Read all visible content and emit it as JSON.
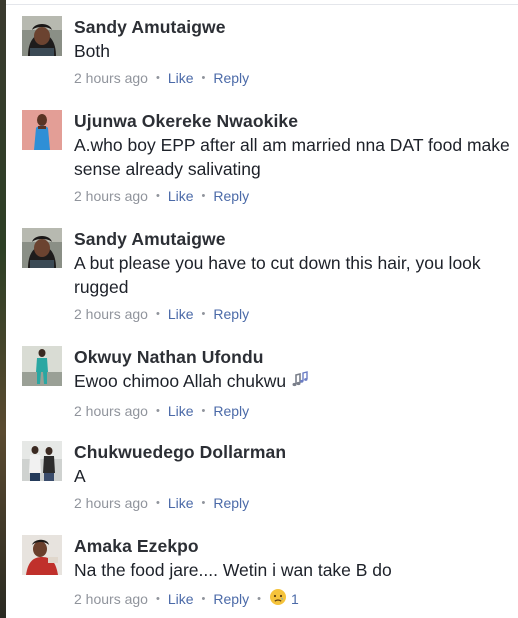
{
  "colors": {
    "author": "#2c2f35",
    "text": "#1d2129",
    "meta": "#90949c",
    "link": "#4b6aa8"
  },
  "comments": [
    {
      "author": "Sandy Amutaigwe",
      "text": "Both",
      "time": "2 hours ago",
      "like": "Like",
      "reply": "Reply",
      "avatar": "avatar-photo-woman-braids"
    },
    {
      "author": "Ujunwa Okereke Nwaokike",
      "text": "A.who boy EPP after all am married nna DAT food make sense already salivating",
      "time": "2 hours ago",
      "like": "Like",
      "reply": "Reply",
      "avatar": "avatar-photo-woman-blue-dress"
    },
    {
      "author": "Sandy Amutaigwe",
      "text": "A  but please you have to cut down this hair, you look rugged",
      "time": "2 hours ago",
      "like": "Like",
      "reply": "Reply",
      "avatar": "avatar-photo-woman-braids"
    },
    {
      "author": "Okwuy Nathan Ufondu",
      "text": "Ewoo chimoo Allah chukwu",
      "emoji": "music-notes-icon",
      "time": "2 hours ago",
      "like": "Like",
      "reply": "Reply",
      "avatar": "avatar-photo-man-teal-outfit"
    },
    {
      "author": "Chukwuedego Dollarman",
      "text": "A",
      "time": "2 hours ago",
      "like": "Like",
      "reply": "Reply",
      "avatar": "avatar-photo-two-men"
    },
    {
      "author": "Amaka Ezekpo",
      "text": "Na the food jare.... Wetin i wan take B do",
      "time": "2 hours ago",
      "like": "Like",
      "reply": "Reply",
      "reaction": "sad-face-icon",
      "reaction_count": "1",
      "avatar": "avatar-photo-woman-red-top"
    }
  ]
}
